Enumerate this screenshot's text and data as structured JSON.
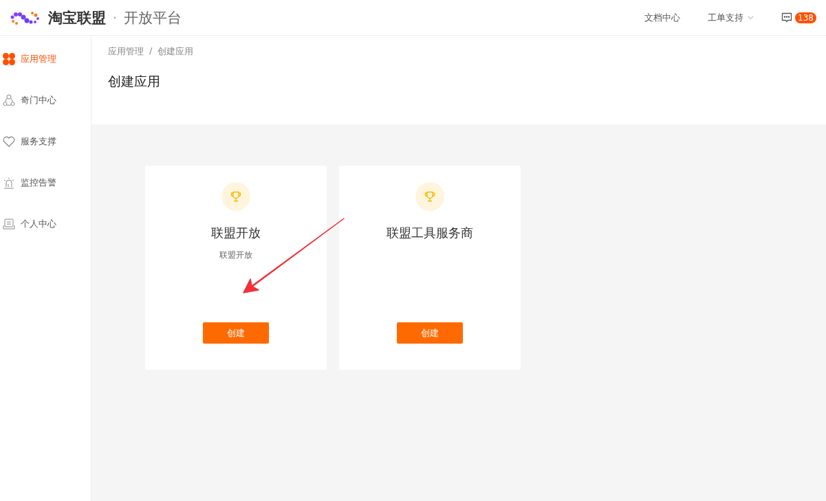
{
  "header": {
    "brand": "淘宝联盟",
    "separator": "·",
    "platform": "开放平台",
    "nav": [
      {
        "label": "文档中心",
        "dropdown": false
      },
      {
        "label": "工单支持",
        "dropdown": true
      }
    ],
    "message_count": "138"
  },
  "sidebar": {
    "items": [
      {
        "label": "应用管理",
        "selected": true
      },
      {
        "label": "奇门中心",
        "selected": false
      },
      {
        "label": "服务支撑",
        "selected": false
      },
      {
        "label": "监控告警",
        "selected": false
      },
      {
        "label": "个人中心",
        "selected": false
      }
    ]
  },
  "breadcrumb": {
    "separator": "/",
    "items": [
      "应用管理",
      "创建应用"
    ]
  },
  "page_title": "创建应用",
  "cards": [
    {
      "title": "联盟开放",
      "description": "联盟开放",
      "button": "创建"
    },
    {
      "title": "联盟工具服务商",
      "button": "创建"
    }
  ]
}
